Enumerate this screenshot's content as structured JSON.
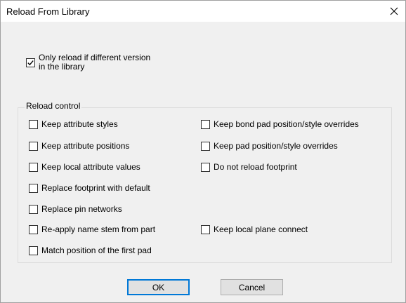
{
  "window": {
    "title": "Reload From Library"
  },
  "top_option": {
    "label_line1": "Only reload if different version",
    "label_line2": "in the library",
    "checked": true
  },
  "reload_control": {
    "group_label": "Reload control",
    "left_options": [
      {
        "label": "Keep attribute styles",
        "checked": false
      },
      {
        "label": "Keep attribute positions",
        "checked": false
      },
      {
        "label": "Keep local attribute values",
        "checked": false
      },
      {
        "label": "Replace footprint with default",
        "checked": false
      },
      {
        "label": "Replace pin networks",
        "checked": false
      },
      {
        "label": "Re-apply name stem from part",
        "checked": false
      },
      {
        "label": "Match position of the first pad",
        "checked": false
      }
    ],
    "right_options": [
      {
        "label": "Keep bond pad position/style overrides",
        "checked": false
      },
      {
        "label": "Keep pad position/style overrides",
        "checked": false
      },
      {
        "label": "Do not reload footprint",
        "checked": false
      },
      {
        "label": "Keep local plane connect",
        "checked": false
      }
    ]
  },
  "buttons": {
    "ok": "OK",
    "cancel": "Cancel"
  },
  "icons": {
    "close": "close-icon",
    "check": "check-icon"
  },
  "colors": {
    "default_button_border": "#0078d7",
    "dialog_background": "#f0f0f0"
  }
}
